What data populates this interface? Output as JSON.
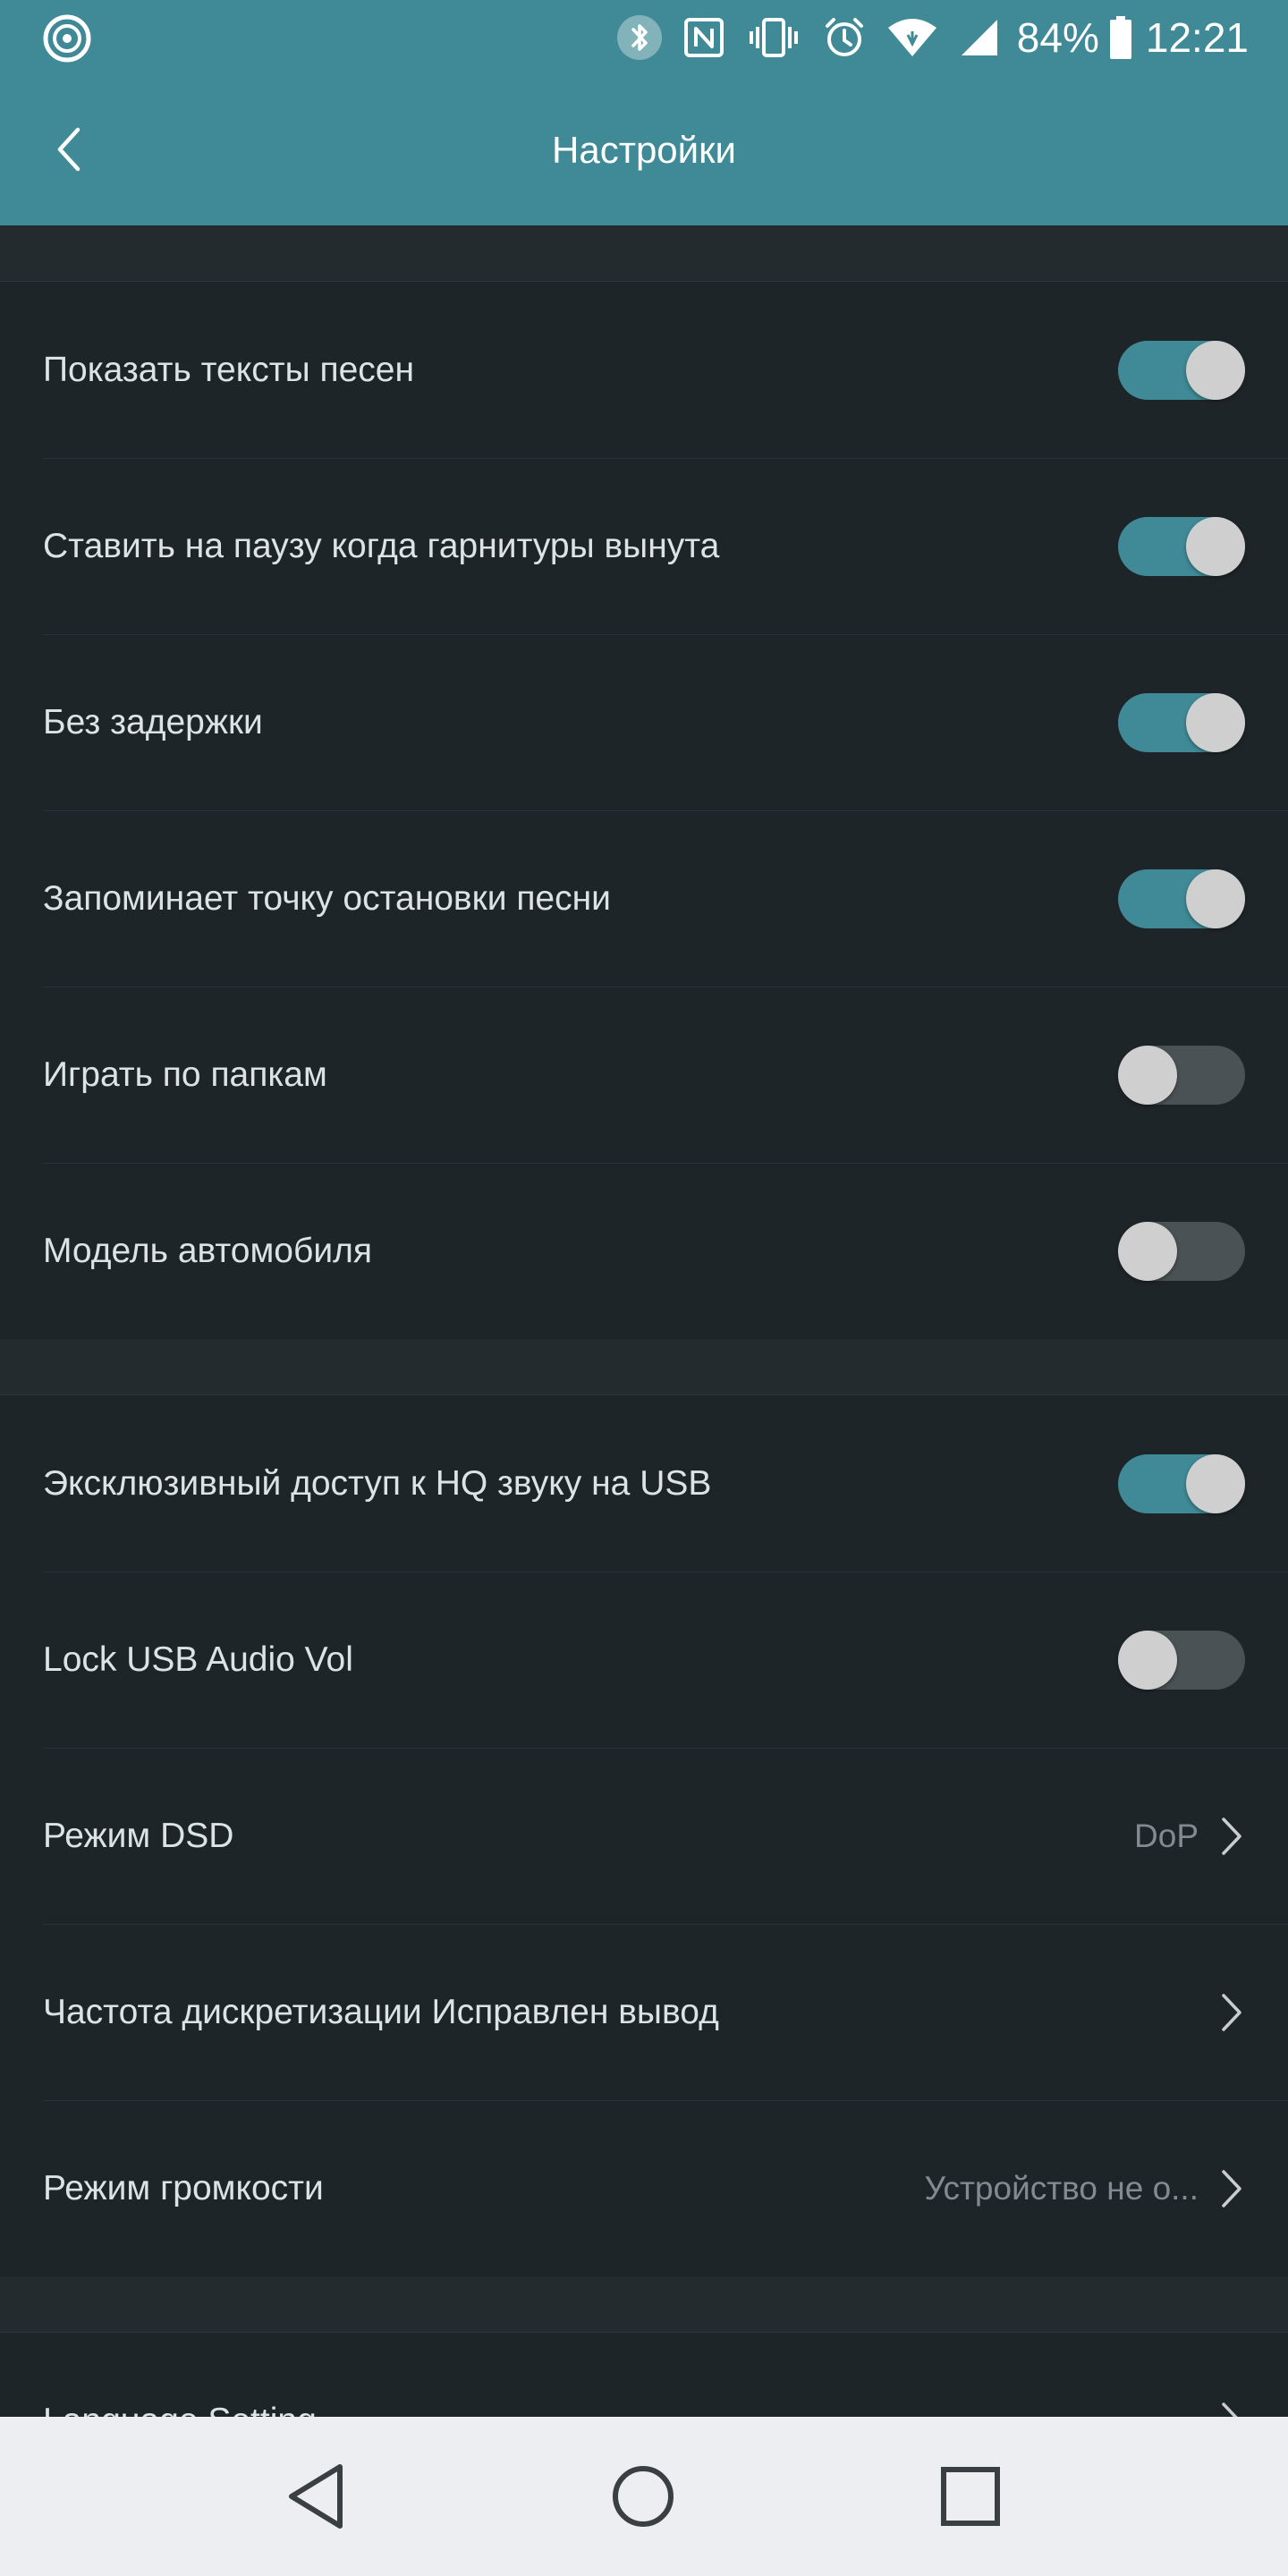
{
  "status_bar": {
    "battery": "84%",
    "time": "12:21",
    "icons": [
      "app-disc-icon",
      "bluetooth-icon",
      "nfc-icon",
      "vibrate-icon",
      "alarm-icon",
      "wifi-icon",
      "signal-icon",
      "battery-icon"
    ]
  },
  "header": {
    "title": "Настройки",
    "back_icon": "chevron-left-icon"
  },
  "sections": [
    {
      "items": [
        {
          "label": "Показать тексты песен",
          "type": "toggle",
          "on": true
        },
        {
          "label": "Ставить на паузу когда гарнитуры вынута",
          "type": "toggle",
          "on": true
        },
        {
          "label": "Без задержки",
          "type": "toggle",
          "on": true
        },
        {
          "label": "Запоминает точку остановки песни",
          "type": "toggle",
          "on": true
        },
        {
          "label": "Играть по папкам",
          "type": "toggle",
          "on": false
        },
        {
          "label": "Модель автомобиля",
          "type": "toggle",
          "on": false
        }
      ]
    },
    {
      "items": [
        {
          "label": "Эксклюзивный доступ к HQ звуку на USB",
          "type": "toggle",
          "on": true
        },
        {
          "label": "Lock USB Audio Vol",
          "type": "toggle",
          "on": false
        },
        {
          "label": "Режим DSD",
          "type": "nav",
          "value": "DoP"
        },
        {
          "label": "Частота дискретизации Исправлен вывод",
          "type": "nav",
          "value": ""
        },
        {
          "label": "Режим громкости",
          "type": "nav",
          "value": "Устройство не о..."
        }
      ]
    },
    {
      "items": [
        {
          "label": "Language Setting",
          "type": "nav",
          "value": ""
        }
      ]
    }
  ],
  "nav_bar": {
    "buttons": [
      "back-triangle-icon",
      "home-circle-icon",
      "recents-square-icon"
    ]
  },
  "colors": {
    "accent": "#3f8a96",
    "background": "#1e2529",
    "text": "#dce3e6",
    "toggle_off_track": "#4a5255",
    "knob": "#cfcfcf",
    "navbar": "#eceef1"
  }
}
